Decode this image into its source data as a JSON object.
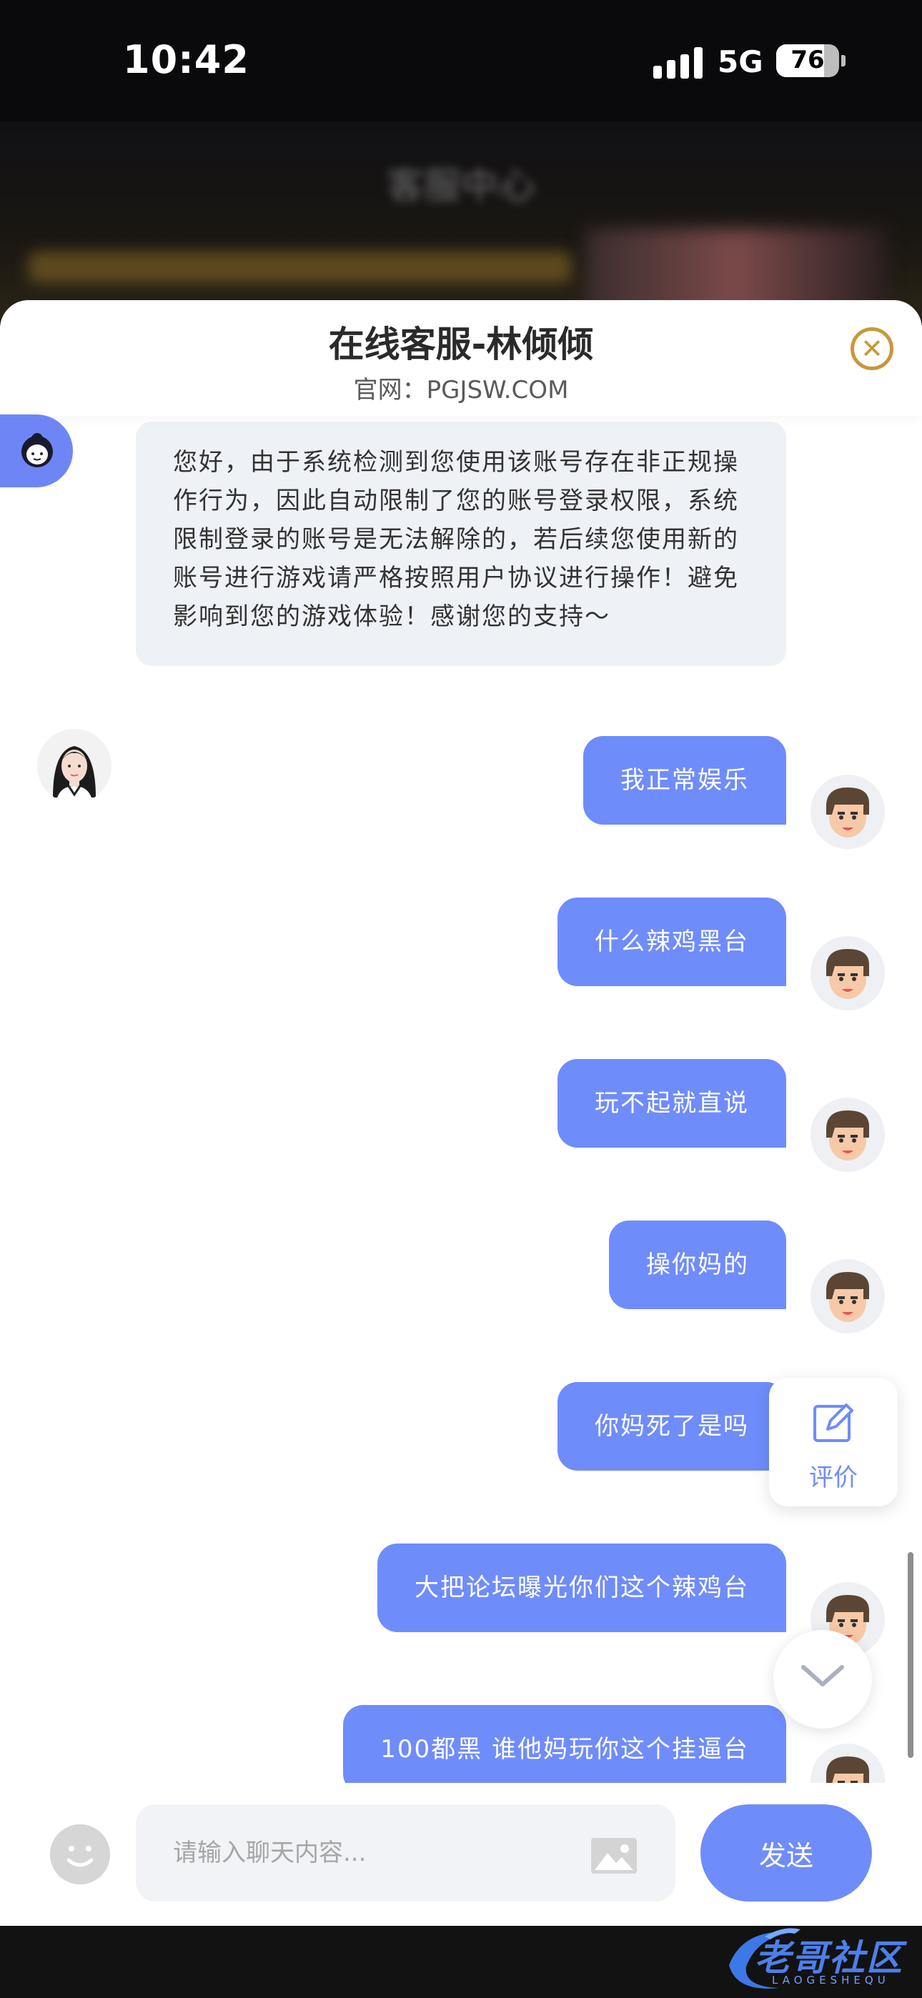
{
  "status_bar": {
    "time": "10:42",
    "network": "5G",
    "battery": "76"
  },
  "background": {
    "title": "客服中心"
  },
  "header": {
    "title": "在线客服-林倾倾",
    "subtitle": "官网：PGJSW.COM"
  },
  "agent_message": "您好，由于系统检测到您使用该账号存在非正规操作行为，因此自动限制了您的账号登录权限，系统限制登录的账号是无法解除的，若后续您使用新的账号进行游戏请严格按照用户协议进行操作！避免影响到您的游戏体验！感谢您的支持～",
  "user_messages": [
    "我正常娱乐",
    "什么辣鸡黑台",
    "玩不起就直说",
    "操你妈的",
    "你妈死了是吗",
    "大把论坛曝光你们这个辣鸡台",
    "100都黑 谁他妈玩你这个挂逼台"
  ],
  "rate_button": {
    "label": "评价"
  },
  "input": {
    "placeholder": "请输入聊天内容..."
  },
  "send_button": {
    "label": "发送"
  },
  "watermark": {
    "text": "老哥社区",
    "sub": "LAOGESHEQU"
  },
  "colors": {
    "accent": "#6f8cfb",
    "close": "#c9973c",
    "agent_bubble": "#eef1f6"
  }
}
